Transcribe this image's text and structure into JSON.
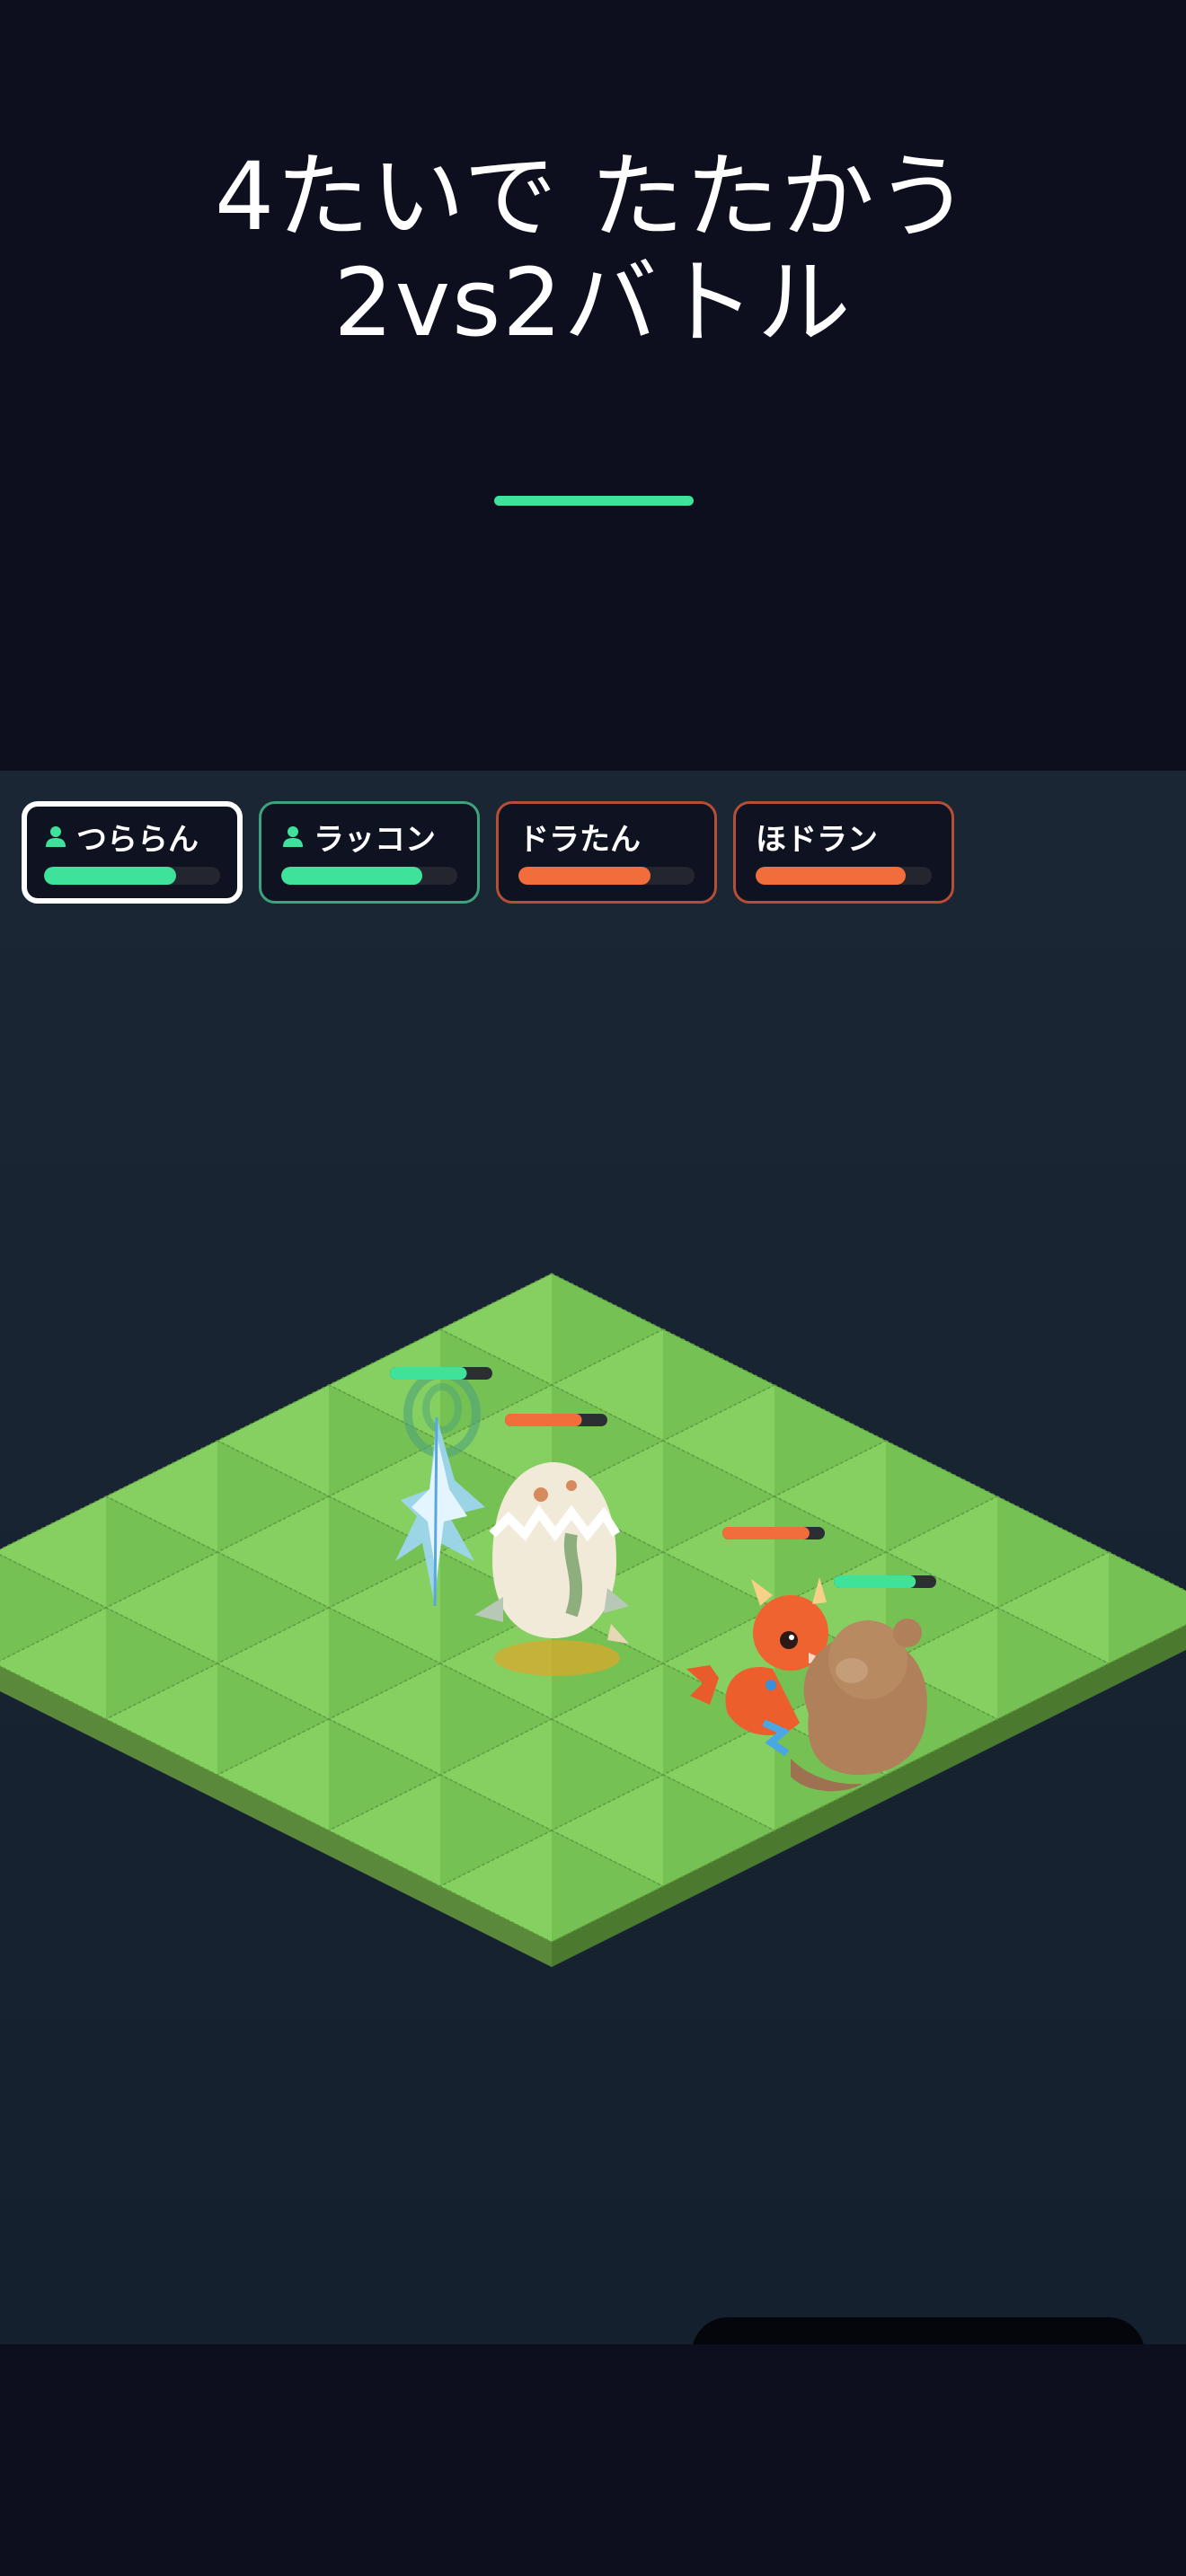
{
  "headline": {
    "line1": "4たいで たたかう",
    "line2": "2vs2バトル"
  },
  "colors": {
    "ally_hp": "#3ee29a",
    "enemy_hp": "#f26d3c",
    "grass_light": "#86d062",
    "grass_dark": "#76c153",
    "background": "#0d0f1e"
  },
  "team": [
    {
      "name": "つららん",
      "side": "ally",
      "player": true,
      "hp": 0.75,
      "active": true
    },
    {
      "name": "ラッコン",
      "side": "ally",
      "player": true,
      "hp": 0.8,
      "active": false
    },
    {
      "name": "ドラたん",
      "side": "enemy",
      "player": false,
      "hp": 0.75,
      "active": false
    },
    {
      "name": "ほドラン",
      "side": "enemy",
      "player": false,
      "hp": 0.85,
      "active": false
    }
  ],
  "field_units": [
    {
      "name": "ice-crystal",
      "side": "ally",
      "hp": 0.75
    },
    {
      "name": "egg-creature",
      "side": "enemy",
      "hp": 0.75
    },
    {
      "name": "red-dragon",
      "side": "enemy",
      "hp": 0.85
    },
    {
      "name": "otter",
      "side": "ally",
      "hp": 0.8
    }
  ]
}
